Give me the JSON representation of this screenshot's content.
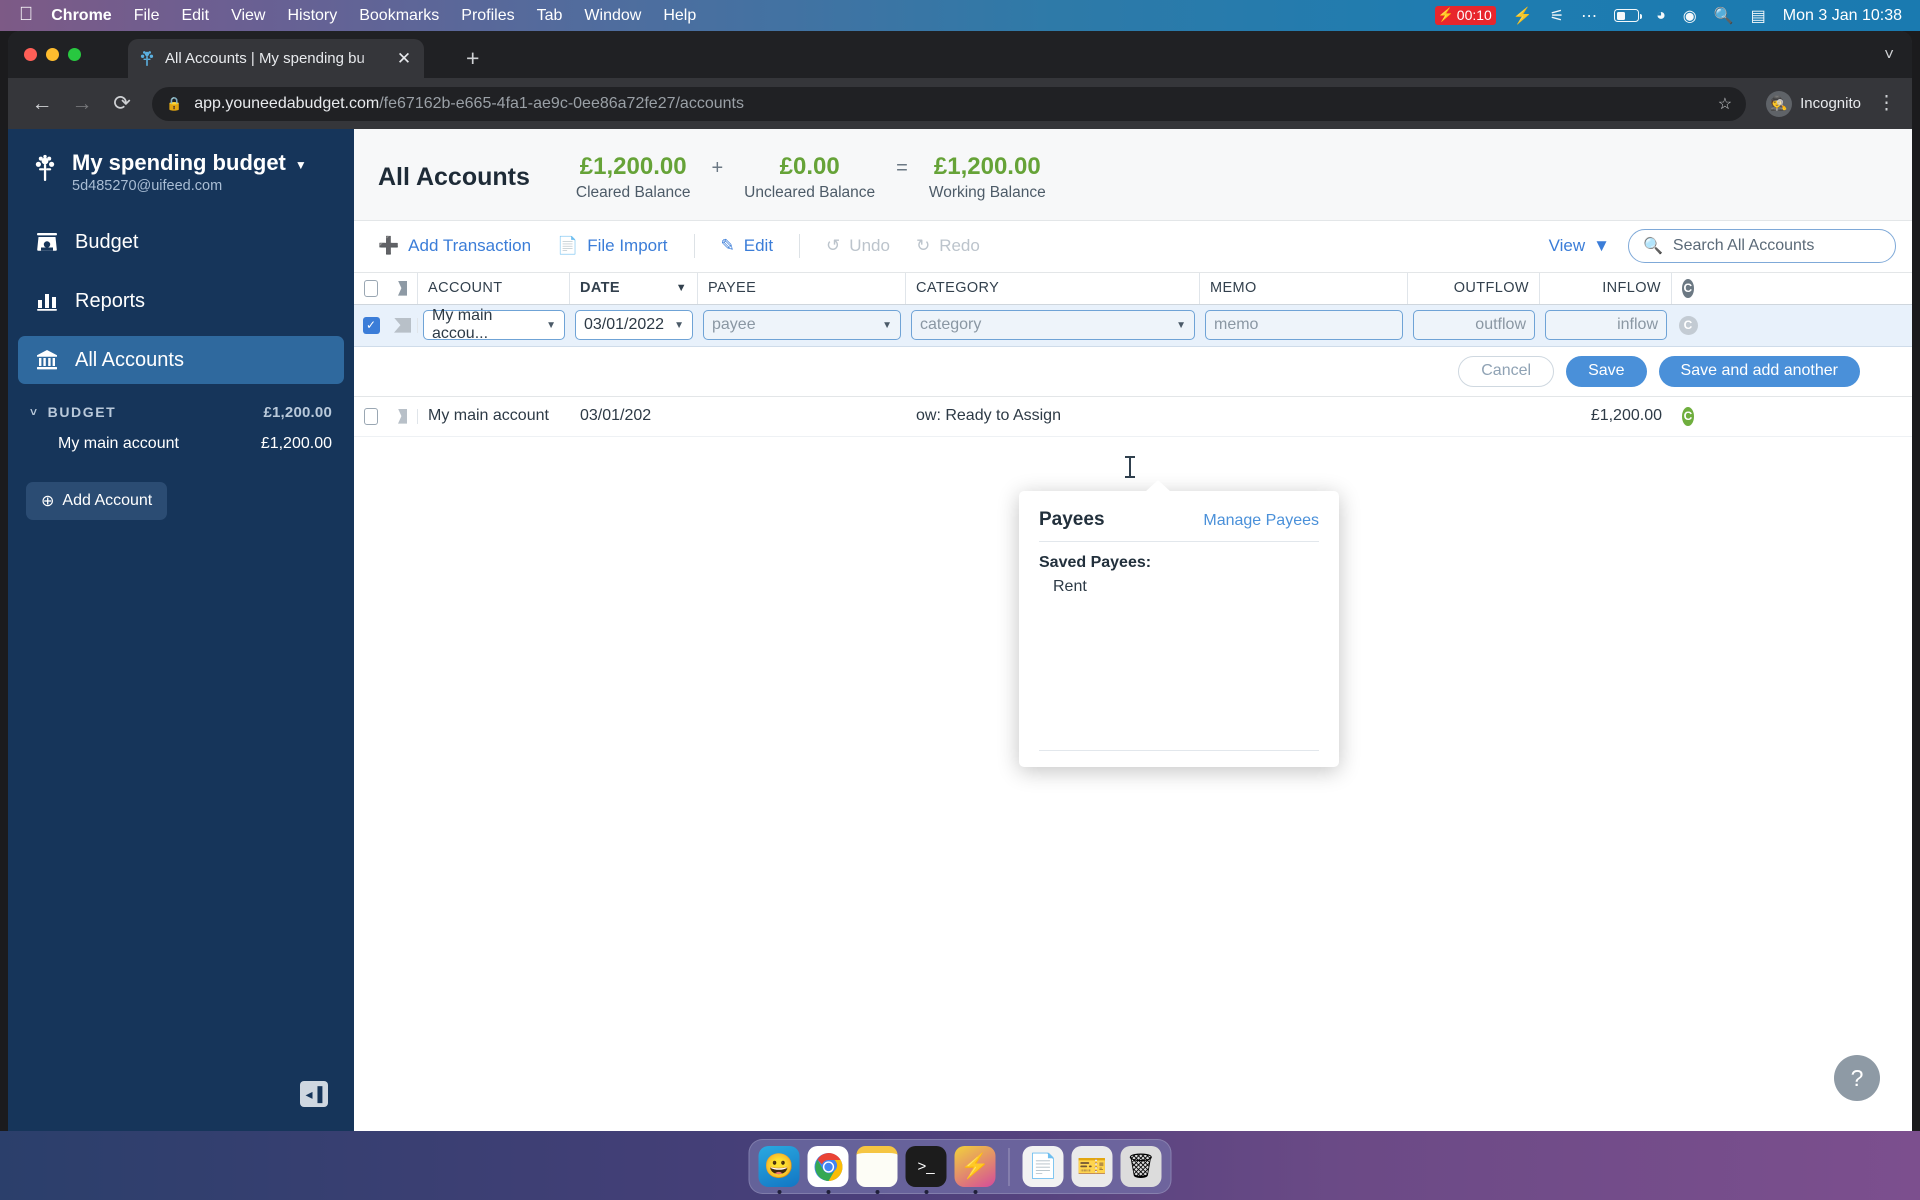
{
  "menubar": {
    "apple_icon": "apple-icon",
    "items": [
      {
        "label": "Chrome",
        "bold": true
      },
      {
        "label": "File",
        "bold": false
      },
      {
        "label": "Edit",
        "bold": false
      },
      {
        "label": "View",
        "bold": false
      },
      {
        "label": "History",
        "bold": false
      },
      {
        "label": "Bookmarks",
        "bold": false
      },
      {
        "label": "Profiles",
        "bold": false
      },
      {
        "label": "Tab",
        "bold": false
      },
      {
        "label": "Window",
        "bold": false
      },
      {
        "label": "Help",
        "bold": false
      }
    ],
    "recording_time": "00:10",
    "status_icons": [
      "bolt-icon",
      "bluetooth-off-icon",
      "dots-icon",
      "battery-icon",
      "wifi-icon",
      "control-center-icon",
      "spotlight-search-icon",
      "screen-mirroring-icon"
    ],
    "clock": "Mon 3 Jan  10:38"
  },
  "browser": {
    "tab_title": "All Accounts | My spending bu",
    "favicon": "ynab-tree-icon",
    "close_tab_icon": "close-icon",
    "new_tab_icon": "plus-icon",
    "tab_list_icon": "chevron-down-icon",
    "back_icon": "arrow-left-icon",
    "forward_icon": "arrow-right-icon",
    "reload_icon": "reload-icon",
    "lock_icon": "lock-icon",
    "url_domain": "app.youneedabudget.com",
    "url_path": "/fe67162b-e665-4fa1-ae9c-0ee86a72fe27/accounts",
    "bookmark_icon": "star-icon",
    "profile_label": "Incognito",
    "profile_icon": "incognito-icon",
    "menu_icon": "kebab-menu-icon"
  },
  "sidebar": {
    "budget_name": "My spending budget",
    "budget_email": "5d485270@uifeed.com",
    "budget_caret_icon": "chevron-down-icon",
    "logo_icon": "ynab-tree-icon",
    "nav": [
      {
        "label": "Budget",
        "icon": "budget-icon",
        "active": false
      },
      {
        "label": "Reports",
        "icon": "bar-chart-icon",
        "active": false
      },
      {
        "label": "All Accounts",
        "icon": "bank-icon",
        "active": true
      }
    ],
    "group": {
      "label": "BUDGET",
      "amount": "£1,200.00",
      "caret_icon": "chevron-down-icon"
    },
    "accounts": [
      {
        "name": "My main account",
        "amount": "£1,200.00"
      }
    ],
    "add_account_label": "Add Account",
    "add_account_icon": "plus-circle-icon",
    "collapse_icon": "collapse-sidebar-icon"
  },
  "account_header": {
    "title": "All Accounts",
    "balances": [
      {
        "amount": "£1,200.00",
        "label": "Cleared Balance"
      },
      {
        "amount": "£0.00",
        "label": "Uncleared Balance"
      },
      {
        "amount": "£1,200.00",
        "label": "Working Balance"
      }
    ],
    "operators": [
      "+",
      "="
    ],
    "amount_color": "#66a338"
  },
  "toolbar": {
    "add_transaction": {
      "label": "Add Transaction",
      "icon": "plus-circle-icon"
    },
    "file_import": {
      "label": "File Import",
      "icon": "file-import-icon"
    },
    "edit": {
      "label": "Edit",
      "icon": "pencil-icon"
    },
    "undo": {
      "label": "Undo",
      "icon": "undo-icon"
    },
    "redo": {
      "label": "Redo",
      "icon": "redo-icon"
    },
    "view": {
      "label": "View",
      "icon": "chevron-down-icon"
    },
    "search": {
      "placeholder": "Search All Accounts",
      "icon": "search-icon"
    }
  },
  "table": {
    "columns": [
      "ACCOUNT",
      "DATE",
      "PAYEE",
      "CATEGORY",
      "MEMO",
      "OUTFLOW",
      "INFLOW"
    ],
    "sorted_column": "DATE",
    "sort_icon": "caret-down-icon",
    "cleared_column_icon": "cleared-c-icon",
    "flag_icon": "flag-icon",
    "select_all_icon": "checkbox-unchecked",
    "edit_row": {
      "checkbox": "checked",
      "account": "My main accou...",
      "date": "03/01/2022",
      "payee_placeholder": "payee",
      "category_placeholder": "category",
      "memo_placeholder": "memo",
      "outflow_placeholder": "outflow",
      "inflow_placeholder": "inflow",
      "dropdown_icon": "caret-down-icon"
    },
    "buttons": {
      "cancel": "Cancel",
      "save": "Save",
      "save_and_add": "Save and add another"
    },
    "rows": [
      {
        "checkbox": "unchecked",
        "account": "My main account",
        "date": "03/01/202",
        "payee": "",
        "category": "ow: Ready to Assign",
        "memo": "",
        "outflow": "",
        "inflow": "£1,200.00",
        "cleared": "C"
      }
    ]
  },
  "payee_popover": {
    "title": "Payees",
    "manage_link": "Manage Payees",
    "section_label": "Saved Payees:",
    "items": [
      "Rent"
    ]
  },
  "help_button": {
    "label": "?",
    "icon": "question-mark-icon"
  },
  "dock": {
    "apps": [
      "finder-icon",
      "chrome-icon",
      "notes-icon",
      "terminal-icon",
      "bolt-app-icon"
    ],
    "others": [
      "preview-icon",
      "ticket-icon",
      "trash-icon"
    ]
  },
  "colors": {
    "accent": "#3b7dd8",
    "sidebar_bg": "#16355a",
    "sidebar_active": "#2f699e",
    "positive": "#66a338",
    "cleared_green": "#6fae3e"
  }
}
